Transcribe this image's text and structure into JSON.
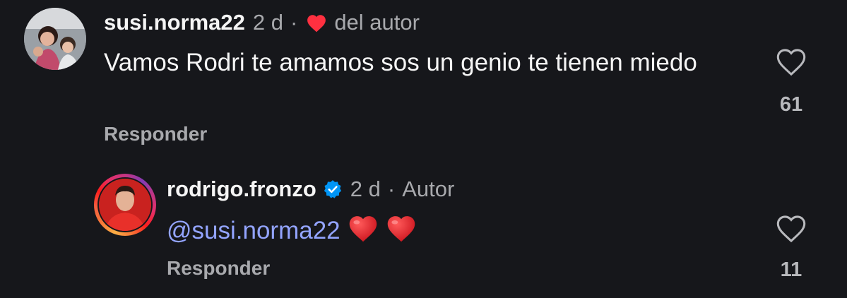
{
  "comments": [
    {
      "username": "susi.norma22",
      "time": "2 d",
      "separator": "·",
      "badge_text": "del autor",
      "text": "Vamos Rodri te amamos sos un genio te tienen miedo",
      "reply_label": "Responder",
      "likes": "61",
      "liked_by_author": true,
      "avatar_icon": "user-photo"
    },
    {
      "username": "rodrigo.fronzo",
      "verified": true,
      "time": "2 d",
      "separator": "·",
      "badge_text": "Autor",
      "mention": "@susi.norma22",
      "emojis": [
        "red-heart",
        "red-heart"
      ],
      "reply_label": "Responder",
      "likes": "11",
      "avatar_icon": "user-photo-story-ring"
    }
  ],
  "colors": {
    "background": "#16171b",
    "heart_red": "#ff3040",
    "verified_blue": "#0095f6",
    "mention_blue": "#93a4ff",
    "muted_text": "#a8a9ad"
  },
  "icons": {
    "like": "heart-outline-icon",
    "author_like": "heart-filled-icon",
    "verified": "verified-badge-icon"
  }
}
